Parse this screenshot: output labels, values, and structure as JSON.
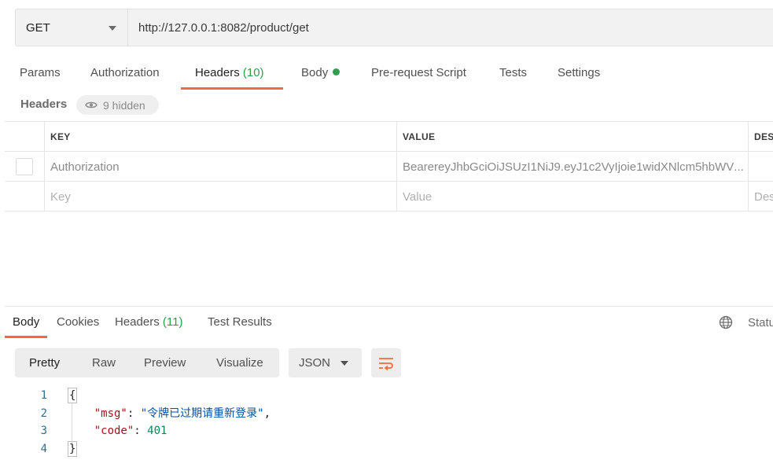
{
  "request": {
    "method": "GET",
    "url": "http://127.0.0.1:8082/product/get"
  },
  "request_tabs": [
    {
      "label": "Params"
    },
    {
      "label": "Authorization"
    },
    {
      "label": "Headers",
      "count": "(10)",
      "active": true
    },
    {
      "label": "Body",
      "dot": true
    },
    {
      "label": "Pre-request Script"
    },
    {
      "label": "Tests"
    },
    {
      "label": "Settings"
    }
  ],
  "headers_section": {
    "title": "Headers",
    "hidden_label": "9 hidden"
  },
  "headers_table": {
    "columns": [
      "KEY",
      "VALUE",
      "DESC"
    ],
    "rows": [
      {
        "key": "Authorization",
        "value": "BearereyJhbGciOiJSUzI1NiJ9.eyJ1c2VyIjoie1widXNlcm5hbWV",
        "ellipsis": "...",
        "description": ""
      }
    ],
    "placeholder": {
      "key": "Key",
      "value": "Value",
      "description": "Des"
    }
  },
  "response_tabs": [
    {
      "label": "Body",
      "active": true
    },
    {
      "label": "Cookies"
    },
    {
      "label": "Headers",
      "count": "(11)"
    },
    {
      "label": "Test Results"
    }
  ],
  "status_label": "Statu",
  "view_modes": [
    "Pretty",
    "Raw",
    "Preview",
    "Visualize"
  ],
  "format": "JSON",
  "response_body": {
    "line_numbers": [
      "1",
      "2",
      "3",
      "4"
    ],
    "open_brace": "{",
    "msg_key": "\"msg\"",
    "msg_value": "\"令牌已过期请重新登录\"",
    "code_key": "\"code\"",
    "code_value": "401",
    "close_brace": "}"
  },
  "colors": {
    "accent": "#f26b3a",
    "count_green": "#2a9d49",
    "body_dot": "#2ea04f"
  }
}
